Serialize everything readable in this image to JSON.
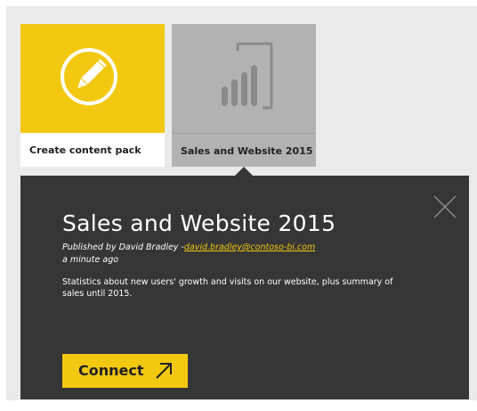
{
  "tiles": [
    {
      "label": "Create content pack",
      "icon": "pencil-icon",
      "color": "#f2c811"
    },
    {
      "label": "Sales and Website 2015",
      "icon": "report-icon",
      "color": "#b2b2b2"
    }
  ],
  "detail": {
    "title": "Sales and Website 2015",
    "published_prefix": "Published by David Bradley -",
    "publisher_email": "david.bradley@contoso-bi.com",
    "time_ago": "a minute ago",
    "description": "Statistics about new users' growth and visits on our website, plus summary of sales until 2015.",
    "connect_label": "Connect",
    "close_icon": "close-icon",
    "connect_icon": "arrow-up-right-icon"
  },
  "colors": {
    "accent": "#f2c811",
    "panel": "#363636",
    "background": "#eaeaea",
    "tile_gray": "#b2b2b2"
  }
}
